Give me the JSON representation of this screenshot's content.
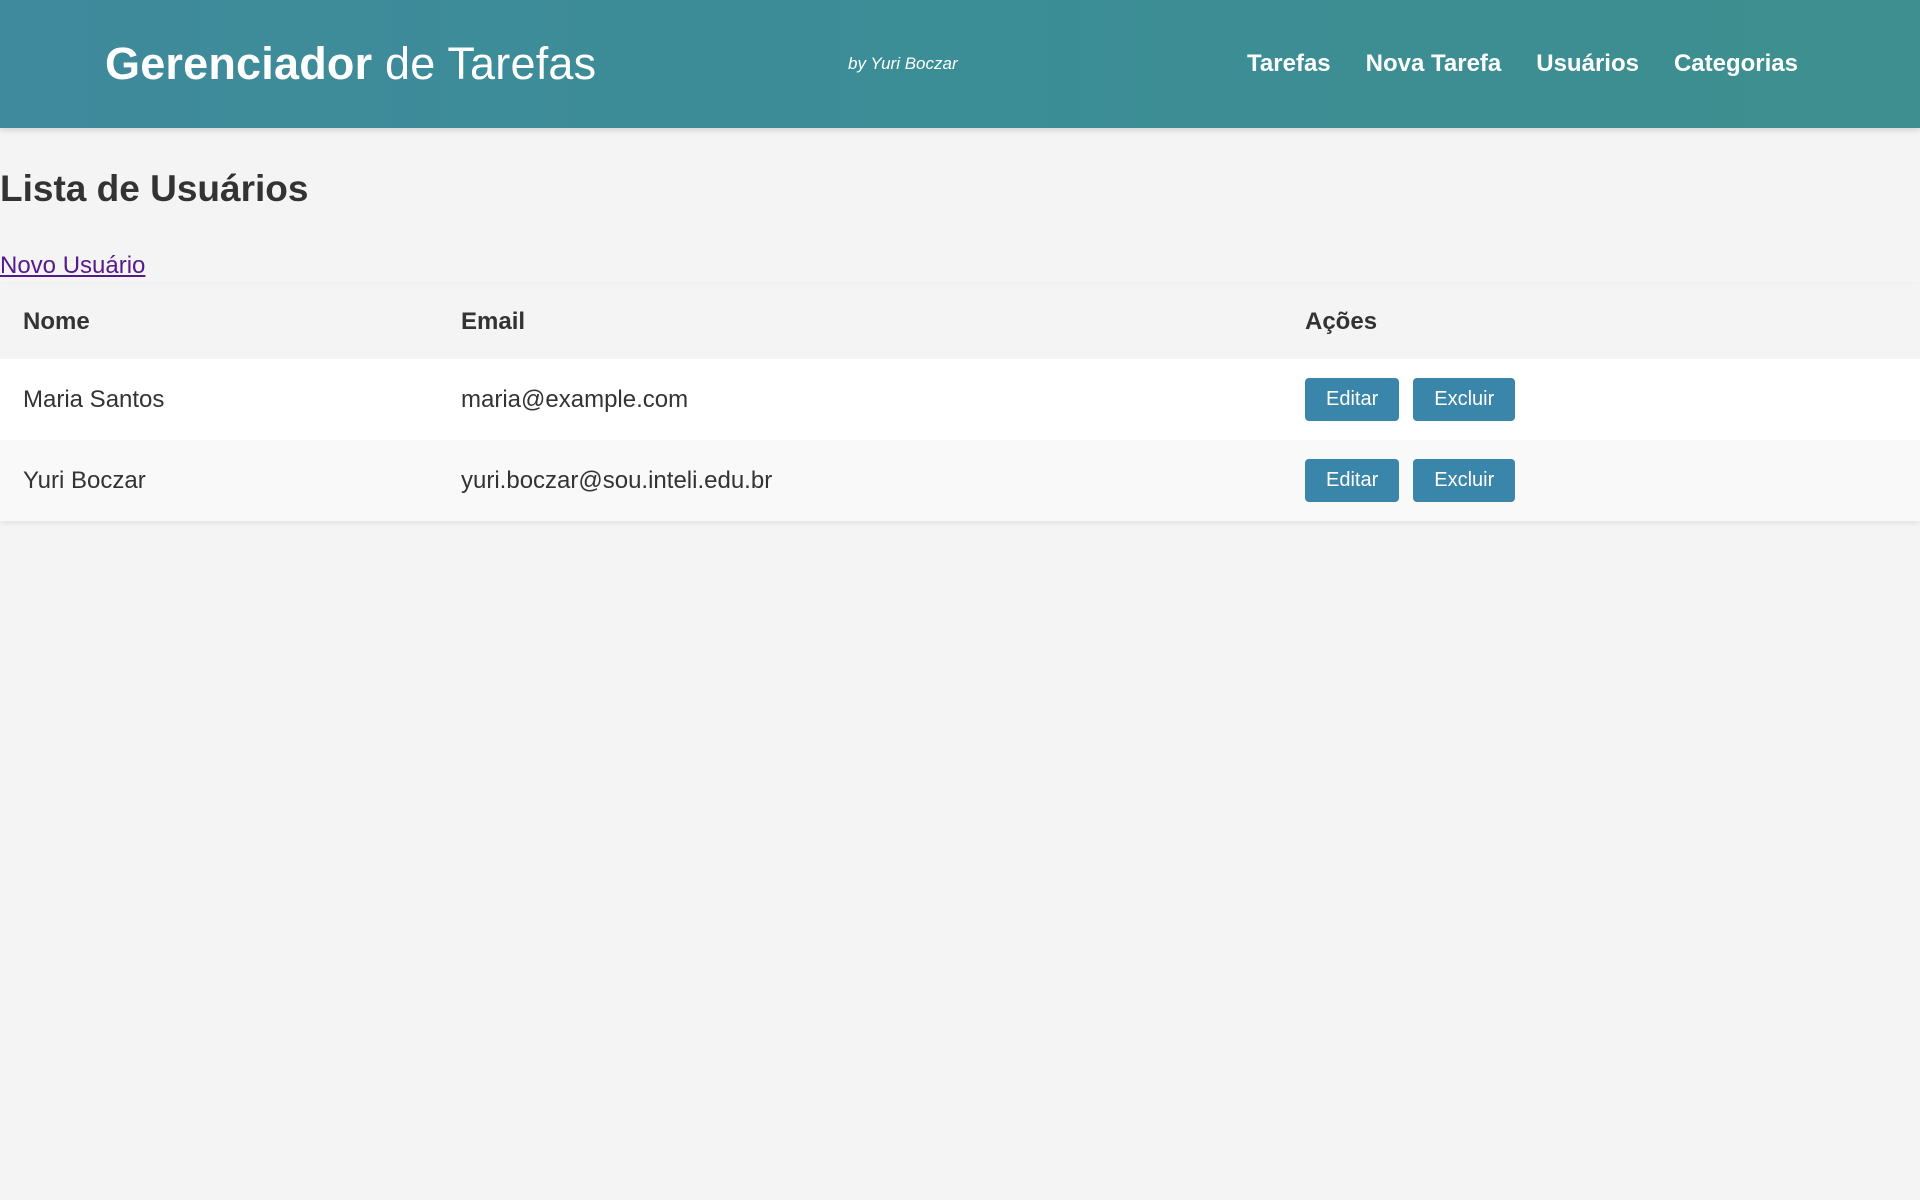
{
  "header": {
    "title_bold": "Gerenciador",
    "title_light": " de Tarefas",
    "byline": "by Yuri Boczar",
    "nav": [
      {
        "label": "Tarefas"
      },
      {
        "label": "Nova Tarefa"
      },
      {
        "label": "Usuários"
      },
      {
        "label": "Categorias"
      }
    ]
  },
  "main": {
    "title": "Lista de Usuários",
    "new_user_link": "Novo Usuário",
    "table": {
      "columns": [
        "Nome",
        "Email",
        "Ações"
      ],
      "rows": [
        {
          "name": "Maria Santos",
          "email": "maria@example.com",
          "edit_label": "Editar",
          "delete_label": "Excluir"
        },
        {
          "name": "Yuri Boczar",
          "email": "yuri.boczar@sou.inteli.edu.br",
          "edit_label": "Editar",
          "delete_label": "Excluir"
        }
      ]
    }
  },
  "colors": {
    "header_gradient_start": "#3f8a9c",
    "header_gradient_end": "#3e8f8f",
    "button_bg": "#3a85aa",
    "link_visited": "#551a8b",
    "page_bg": "#f4f4f4"
  }
}
